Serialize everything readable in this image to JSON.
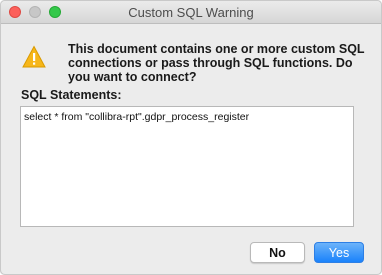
{
  "window": {
    "title": "Custom SQL Warning"
  },
  "dialog": {
    "icon": "warning-triangle-icon",
    "message": "This document contains one or more custom SQL connections or pass through SQL functions. Do you want to connect?",
    "sql_label": "SQL Statements:",
    "sql_statements": "select * from \"collibra-rpt\".gdpr_process_register"
  },
  "buttons": {
    "no_label": "No",
    "yes_label": "Yes"
  },
  "colors": {
    "accent": "#1a82fb",
    "warning": "#f5b500"
  }
}
